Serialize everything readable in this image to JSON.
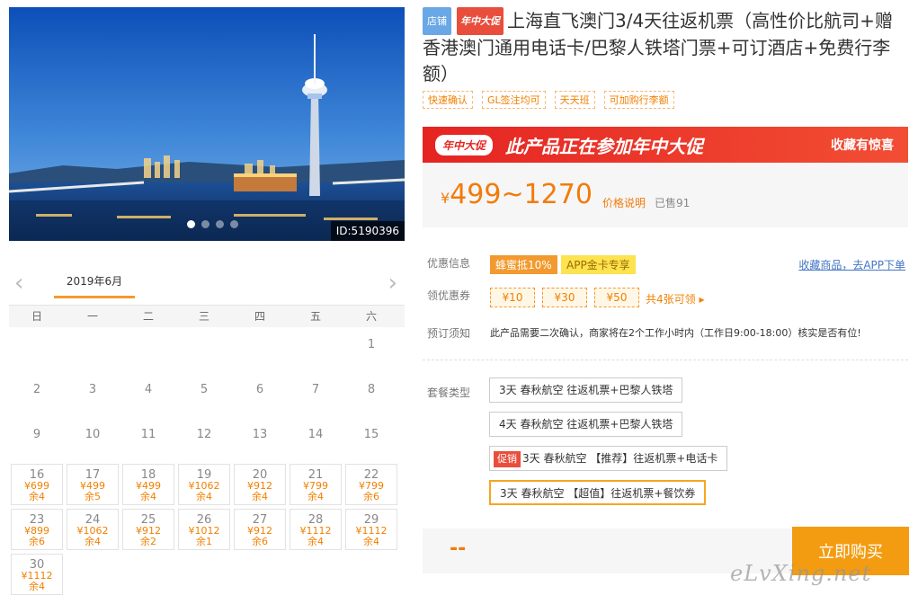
{
  "gallery": {
    "image_id": "ID:5190396",
    "dots": 4,
    "active_dot": 0
  },
  "calendar": {
    "month": "2019年6月",
    "weekdays": [
      "日",
      "一",
      "二",
      "三",
      "四",
      "五",
      "六"
    ],
    "empty_before": 6,
    "days": [
      {
        "d": "1"
      },
      {
        "d": "2"
      },
      {
        "d": "3"
      },
      {
        "d": "4"
      },
      {
        "d": "5"
      },
      {
        "d": "6"
      },
      {
        "d": "7"
      },
      {
        "d": "8"
      },
      {
        "d": "9"
      },
      {
        "d": "10"
      },
      {
        "d": "11"
      },
      {
        "d": "12"
      },
      {
        "d": "13"
      },
      {
        "d": "14"
      },
      {
        "d": "15"
      },
      {
        "d": "16",
        "price": "¥699",
        "stock": "余4"
      },
      {
        "d": "17",
        "price": "¥499",
        "stock": "余5"
      },
      {
        "d": "18",
        "price": "¥499",
        "stock": "余4"
      },
      {
        "d": "19",
        "price": "¥1062",
        "stock": "余4"
      },
      {
        "d": "20",
        "price": "¥912",
        "stock": "余4"
      },
      {
        "d": "21",
        "price": "¥799",
        "stock": "余4"
      },
      {
        "d": "22",
        "price": "¥799",
        "stock": "余6"
      },
      {
        "d": "23",
        "price": "¥899",
        "stock": "余6"
      },
      {
        "d": "24",
        "price": "¥1062",
        "stock": "余4"
      },
      {
        "d": "25",
        "price": "¥912",
        "stock": "余2"
      },
      {
        "d": "26",
        "price": "¥1012",
        "stock": "余1"
      },
      {
        "d": "27",
        "price": "¥912",
        "stock": "余6"
      },
      {
        "d": "28",
        "price": "¥1112",
        "stock": "余4"
      },
      {
        "d": "29",
        "price": "¥1112",
        "stock": "余4"
      },
      {
        "d": "30",
        "price": "¥1112",
        "stock": "余4"
      }
    ]
  },
  "product": {
    "tag_shop": "店铺",
    "tag_promo": "年中大促",
    "title": "上海直飞澳门3/4天往返机票（高性价比航司+赠香港澳门通用电话卡/巴黎人铁塔门票+可订酒店+免费行李额）",
    "features": [
      "快速确认",
      "GL签注均可",
      "天天班",
      "可加购行李额"
    ]
  },
  "banner": {
    "logo": "年中大促",
    "main": "此产品正在参加年中大促",
    "right": "收藏有惊喜"
  },
  "price": {
    "currency": "¥",
    "range": "499~1270",
    "note": "价格说明",
    "sold": "已售91"
  },
  "discount": {
    "label": "优惠信息",
    "tag1": "蜂蜜抵10%",
    "tag2": "APP金卡专享",
    "fav_link": "收藏商品，去APP下单"
  },
  "coupons": {
    "label": "领优惠券",
    "items": [
      "¥10",
      "¥30",
      "¥50"
    ],
    "more": "共4张可领 ▸"
  },
  "notice": {
    "label": "预订须知",
    "text": "此产品需要二次确认，商家将在2个工作小时内（工作日9:00-18:00）核实是否有位!"
  },
  "packages": {
    "label": "套餐类型",
    "items": [
      {
        "badge": "",
        "text": "3天 春秋航空 往返机票+巴黎人铁塔"
      },
      {
        "badge": "",
        "text": "4天 春秋航空 往返机票+巴黎人铁塔"
      },
      {
        "badge": "促销",
        "text": "3天 春秋航空 【推荐】往返机票+电话卡"
      },
      {
        "badge": "",
        "text": "3天 春秋航空 【超值】往返机票+餐饮券"
      }
    ],
    "selected": 3
  },
  "buy": {
    "total": "--",
    "button": "立即购买"
  },
  "watermark": "eLvXing.net",
  "colors": {
    "accent": "#f39c12",
    "price": "#f27b0b",
    "promo_red": "#e52422",
    "link": "#4276c4"
  }
}
